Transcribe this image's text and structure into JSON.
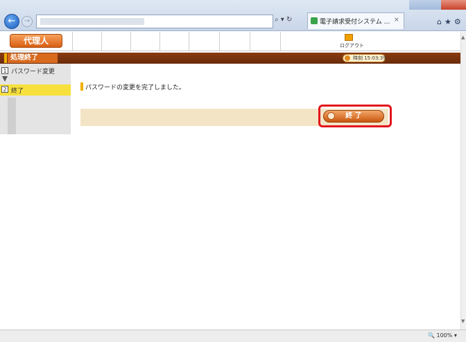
{
  "browser": {
    "back_glyph": "←",
    "forward_glyph": "→",
    "address_icons": "⌕ ▾ ↻",
    "tab_title": "電子請求受付システム ...",
    "tab_close": "×",
    "nav_icons": "⌂★⚙",
    "zoom": "🔍 100% ▾"
  },
  "header": {
    "user_button": "代理人",
    "logout_label": "ログアウト",
    "page_title": "処理終了",
    "time_label": "時刻 15:03:39"
  },
  "steps": [
    {
      "num": "1",
      "label": "パスワード変更"
    },
    {
      "num": "2",
      "label": "終了"
    }
  ],
  "main": {
    "message": "パスワードの変更を完了しました。",
    "end_button": "終 了"
  },
  "colors": {
    "accent_orange": "#d85f12",
    "title_bar_brown": "#7a3510",
    "step_active": "#f7e03c",
    "highlight_red": "#e3141b",
    "action_bar": "#f4e4c6"
  }
}
